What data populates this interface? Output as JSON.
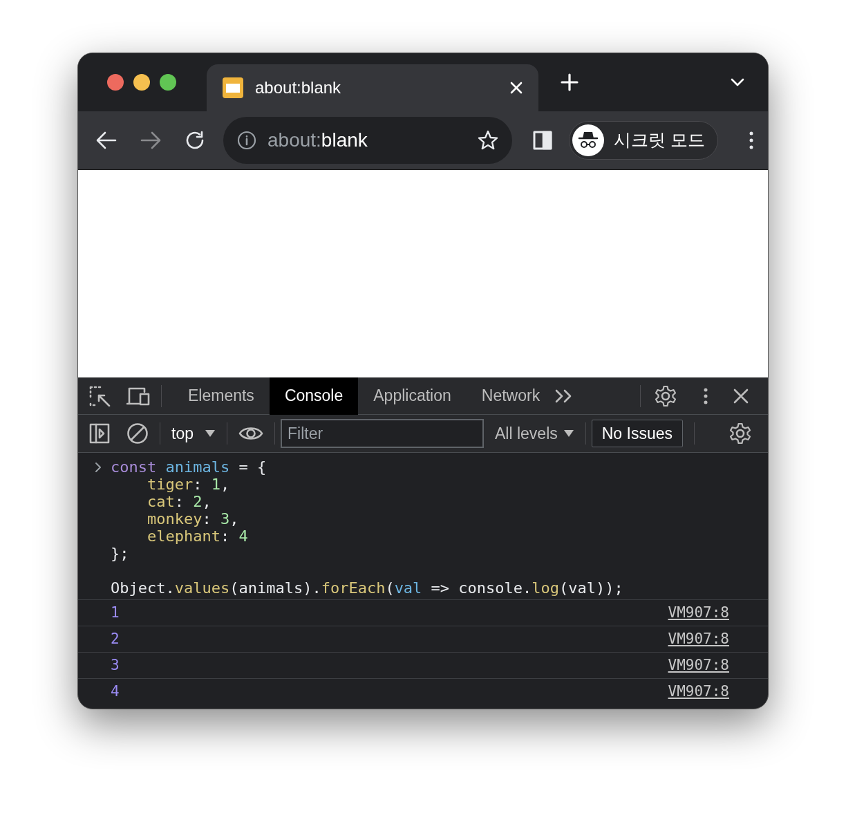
{
  "browser_tabs": [
    {
      "title": "about:blank",
      "selected": true
    }
  ],
  "toolbar": {
    "forward_disabled": true,
    "address": {
      "scheme": "about:",
      "path": "blank"
    },
    "profile": "시크릿 모드"
  },
  "devtools": {
    "tabs": [
      {
        "label": "Elements",
        "selected": false
      },
      {
        "label": "Console",
        "selected": true
      },
      {
        "label": "Application",
        "selected": false
      },
      {
        "label": "Network",
        "selected": false
      }
    ],
    "context": "top",
    "filter": {
      "placeholder": "Filter"
    },
    "levels": "All levels",
    "issues": "No Issues",
    "input_lines": [
      {
        "indented": false,
        "gap_before": false,
        "tokens": [
          {
            "t": "const ",
            "kind": "keyword"
          },
          {
            "t": "animals",
            "kind": "variable"
          },
          {
            "t": " = {",
            "kind": "plain"
          }
        ]
      },
      {
        "indented": true,
        "gap_before": false,
        "tokens": [
          {
            "t": "tiger",
            "kind": "property"
          },
          {
            "t": ": ",
            "kind": "plain"
          },
          {
            "t": "1",
            "kind": "number"
          },
          {
            "t": ",",
            "kind": "plain"
          }
        ]
      },
      {
        "indented": true,
        "gap_before": false,
        "tokens": [
          {
            "t": "cat",
            "kind": "property"
          },
          {
            "t": ": ",
            "kind": "plain"
          },
          {
            "t": "2",
            "kind": "number"
          },
          {
            "t": ",",
            "kind": "plain"
          }
        ]
      },
      {
        "indented": true,
        "gap_before": false,
        "tokens": [
          {
            "t": "monkey",
            "kind": "property"
          },
          {
            "t": ": ",
            "kind": "plain"
          },
          {
            "t": "3",
            "kind": "number"
          },
          {
            "t": ",",
            "kind": "plain"
          }
        ]
      },
      {
        "indented": true,
        "gap_before": false,
        "tokens": [
          {
            "t": "elephant",
            "kind": "property"
          },
          {
            "t": ": ",
            "kind": "plain"
          },
          {
            "t": "4",
            "kind": "number"
          }
        ]
      },
      {
        "indented": false,
        "gap_before": false,
        "tokens": [
          {
            "t": "};",
            "kind": "plain"
          }
        ]
      },
      {
        "indented": false,
        "gap_before": true,
        "tokens": [
          {
            "t": "Object.",
            "kind": "plain"
          },
          {
            "t": "values",
            "kind": "method"
          },
          {
            "t": "(animals).",
            "kind": "plain"
          },
          {
            "t": "forEach",
            "kind": "method"
          },
          {
            "t": "(",
            "kind": "plain"
          },
          {
            "t": "val",
            "kind": "variable"
          },
          {
            "t": " => console.",
            "kind": "plain"
          },
          {
            "t": "log",
            "kind": "method"
          },
          {
            "t": "(val));",
            "kind": "plain"
          }
        ]
      }
    ],
    "output": [
      {
        "value": "1",
        "source": "VM907:8"
      },
      {
        "value": "2",
        "source": "VM907:8"
      },
      {
        "value": "3",
        "source": "VM907:8"
      },
      {
        "value": "4",
        "source": "VM907:8"
      }
    ]
  }
}
